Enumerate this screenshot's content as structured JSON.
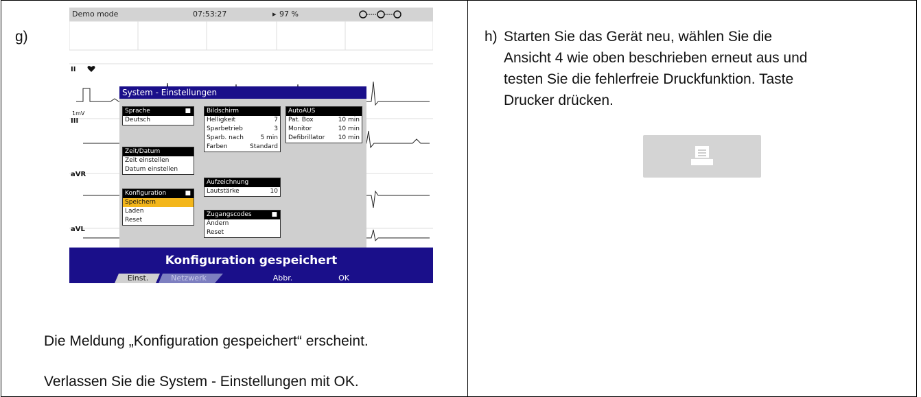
{
  "left_cell": {
    "label": "g)",
    "message_text": "Die Meldung „Konfiguration gespeichert“ erscheint.",
    "exit_text": "Verlassen Sie die System - Einstellungen mit OK."
  },
  "right_cell": {
    "label": "h)",
    "instruction_lines": [
      "Starten Sie das Gerät neu, wählen Sie die",
      "Ansicht 4 wie oben beschrieben erneut aus und",
      "testen Sie die fehlerfreie Druckfunktion. Taste",
      "Drucker drücken."
    ],
    "printer_button_icon": "printer-icon"
  },
  "device": {
    "status_bar": {
      "mode": "Demo mode",
      "time": "07:53:27",
      "battery": "97 %"
    },
    "leads": [
      "II",
      "1mV",
      "III",
      "aVR",
      "aVL"
    ],
    "dialog": {
      "title": "System - Einstellungen",
      "sprache": {
        "header": "Sprache",
        "value": "Deutsch"
      },
      "zeit": {
        "header": "Zeit/Datum",
        "items": [
          "Zeit einstellen",
          "Datum einstellen"
        ]
      },
      "konfiguration": {
        "header": "Konfiguration",
        "items": [
          "Speichern",
          "Laden",
          "Reset"
        ],
        "selected": "Speichern"
      },
      "bildschirm": {
        "header": "Bildschirm",
        "rows": [
          {
            "label": "Helligkeit",
            "value": "7"
          },
          {
            "label": "Sparbetrieb",
            "value": "3"
          },
          {
            "label": "Sparb. nach",
            "value": "5 min"
          },
          {
            "label": "Farben",
            "value": "Standard"
          }
        ]
      },
      "aufzeichnung": {
        "header": "Aufzeichnung",
        "rows": [
          {
            "label": "Lautstärke",
            "value": "10"
          }
        ]
      },
      "zugangscodes": {
        "header": "Zugangscodes",
        "items": [
          "Ändern",
          "Reset"
        ]
      },
      "autoaus": {
        "header": "AutoAUS",
        "rows": [
          {
            "label": "Pat. Box",
            "value": "10 min"
          },
          {
            "label": "Monitor",
            "value": "10 min"
          },
          {
            "label": "Defibrillator",
            "value": "10 min"
          }
        ]
      }
    },
    "message_bar": "Konfiguration gespeichert",
    "softkeys": [
      "Einst.",
      "Netzwerk",
      "Abbr.",
      "OK"
    ],
    "colors": {
      "dialog_blue": "#1a0f8a",
      "selection": "#f3b61b",
      "panel_bg": "#cfcfcf"
    }
  }
}
